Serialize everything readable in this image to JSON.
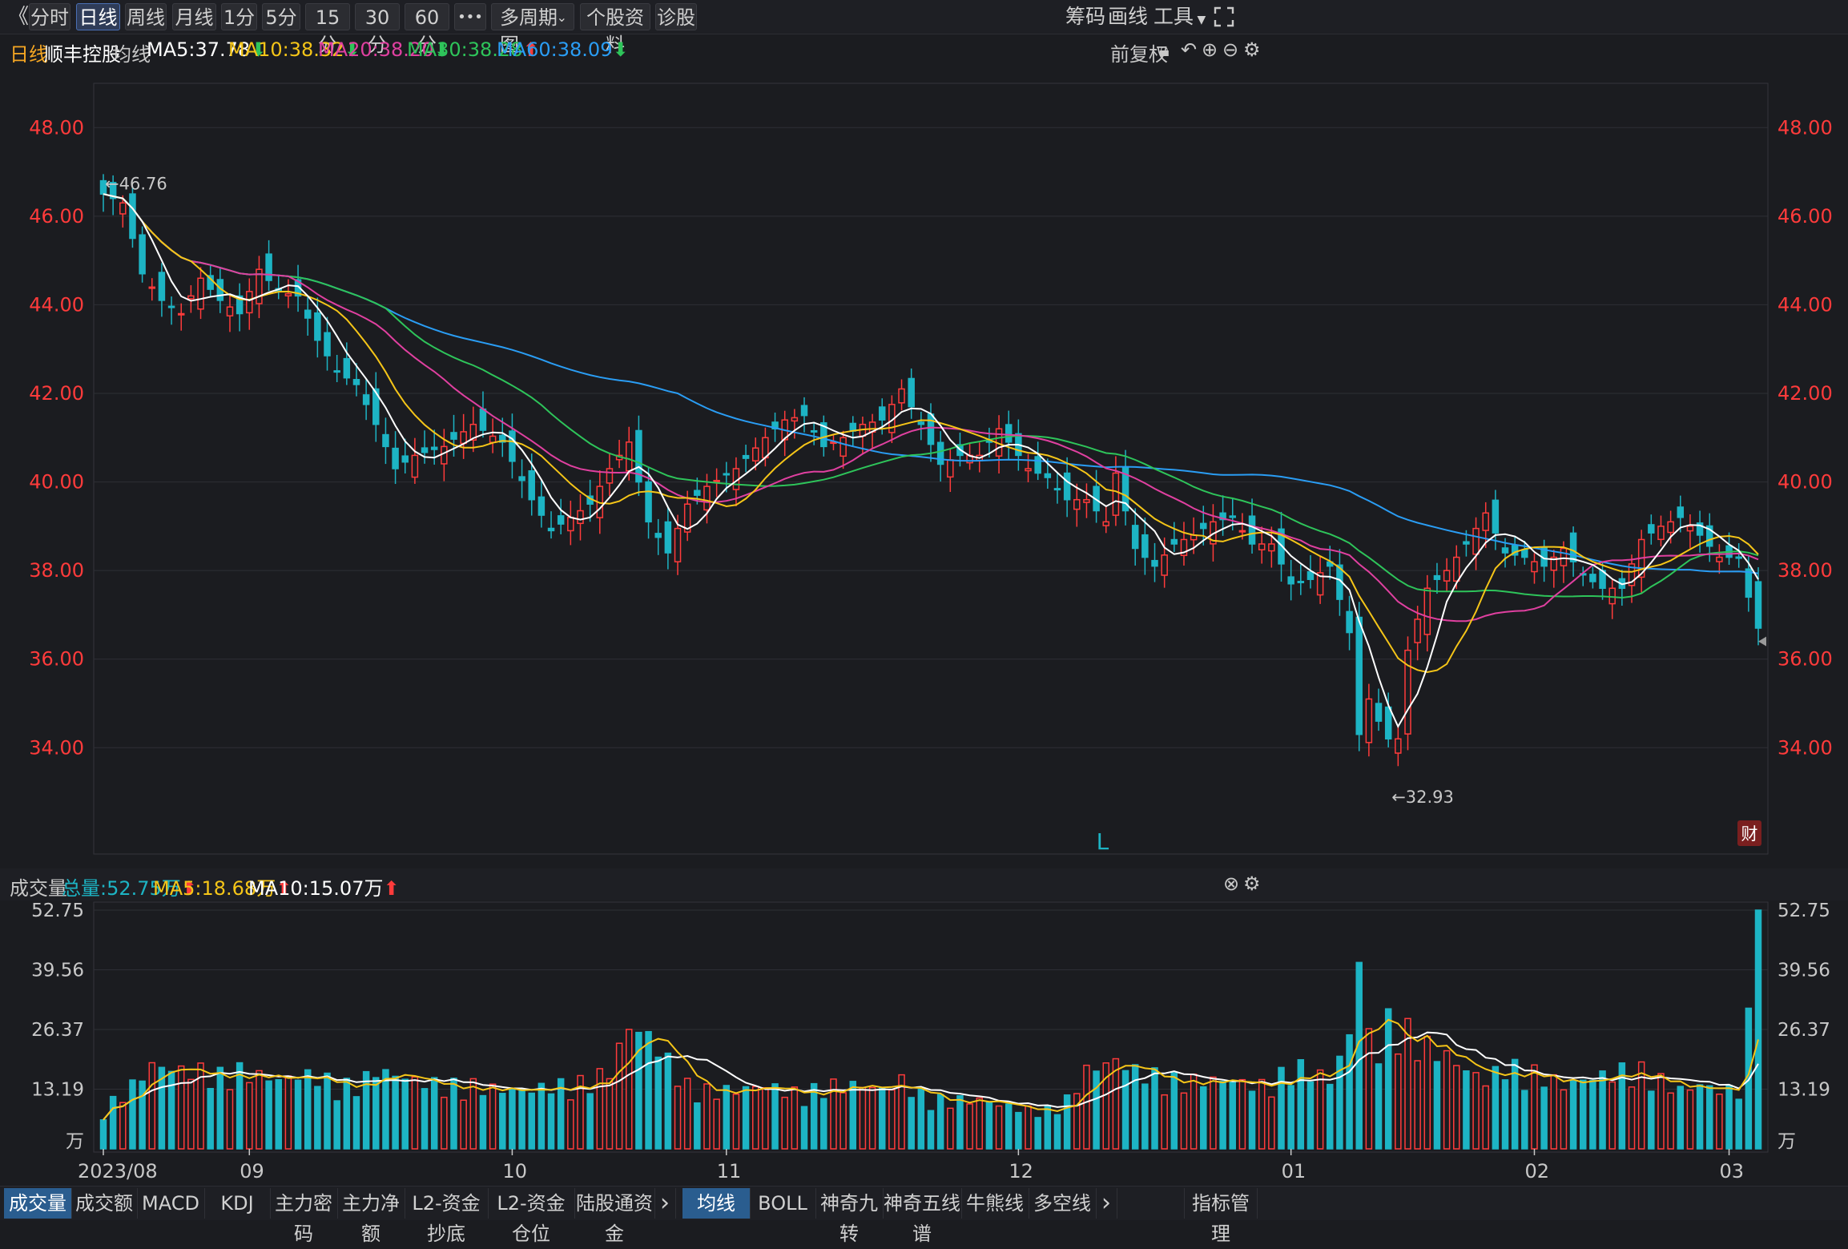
{
  "toolbar": {
    "back_glyph": "《",
    "periods": [
      "分时",
      "日线",
      "周线",
      "月线",
      "1分",
      "5分",
      "15分",
      "30分",
      "60分"
    ],
    "active_period": "日线",
    "more": "•••",
    "multi_period": "多周期图",
    "profile": "个股资料",
    "diagnose": "诊股",
    "right": [
      "筹码",
      "画线",
      "工具"
    ]
  },
  "ma_bar": {
    "period": "日线",
    "stock_name": "顺丰控股",
    "label": "均线",
    "ma5": "MA5:37.78",
    "ma10": "MA10:38.32",
    "ma20": "MA20:38.20",
    "ma30": "MA30:38.28",
    "ma60": "MA60:38.09",
    "adjust": "前复权"
  },
  "volume_bar": {
    "label": "成交量",
    "total": "总量:52.75万",
    "ma5": "MA5:18.68万",
    "ma10": "MA10:15.07万"
  },
  "chart_data": {
    "type": "candlestick",
    "price_axis": {
      "min": 31.6,
      "max": 49.0,
      "ticks": [
        "48.00",
        "46.00",
        "44.00",
        "42.00",
        "40.00",
        "38.00",
        "36.00",
        "34.00"
      ]
    },
    "volume_axis": {
      "max": 52.75,
      "ticks": [
        "52.75",
        "39.56",
        "26.37",
        "13.19"
      ],
      "unit": "万"
    },
    "x_labels": [
      "2023/08",
      "09",
      "10",
      "11",
      "12",
      "01",
      "02",
      "03"
    ],
    "annotations": {
      "high": "←46.76",
      "low": "←32.93",
      "marker": "L",
      "badge": "财"
    },
    "colors": {
      "up": "#ff3b3b",
      "down": "#1db4c4",
      "ma5": "#ffffff",
      "ma10": "#f5c518",
      "ma20": "#e040a0",
      "ma30": "#2ec45a",
      "ma60": "#2a9df4",
      "vol_ma5": "#f5c518",
      "vol_ma10": "#ffffff"
    },
    "anchors": [
      [
        0,
        46.5
      ],
      [
        2,
        46.3
      ],
      [
        4,
        44.7
      ],
      [
        6,
        44.1
      ],
      [
        8,
        43.8
      ],
      [
        10,
        44.6
      ],
      [
        12,
        44.1
      ],
      [
        14,
        43.8
      ],
      [
        16,
        44.8
      ],
      [
        18,
        44.3
      ],
      [
        20,
        44.2
      ],
      [
        22,
        43.2
      ],
      [
        24,
        42.5
      ],
      [
        26,
        42.2
      ],
      [
        28,
        41.3
      ],
      [
        30,
        40.3
      ],
      [
        32,
        40.6
      ],
      [
        35,
        40.8
      ],
      [
        38,
        41.3
      ],
      [
        41,
        40.9
      ],
      [
        44,
        39.6
      ],
      [
        46,
        38.9
      ],
      [
        48,
        39.2
      ],
      [
        50,
        39.5
      ],
      [
        52,
        40.3
      ],
      [
        54,
        40.9
      ],
      [
        56,
        39.1
      ],
      [
        58,
        38.4
      ],
      [
        60,
        39.5
      ],
      [
        62,
        39.9
      ],
      [
        65,
        40.3
      ],
      [
        68,
        41.0
      ],
      [
        70,
        41.4
      ],
      [
        72,
        41.5
      ],
      [
        74,
        40.8
      ],
      [
        76,
        41.0
      ],
      [
        78,
        41.3
      ],
      [
        80,
        41.4
      ],
      [
        82,
        42.1
      ],
      [
        84,
        41.3
      ],
      [
        86,
        40.4
      ],
      [
        88,
        40.6
      ],
      [
        90,
        40.6
      ],
      [
        92,
        41.2
      ],
      [
        95,
        40.3
      ],
      [
        97,
        40.1
      ],
      [
        99,
        39.6
      ],
      [
        101,
        39.6
      ],
      [
        103,
        39.1
      ],
      [
        104,
        40.2
      ],
      [
        106,
        38.5
      ],
      [
        108,
        38.1
      ],
      [
        110,
        38.6
      ],
      [
        112,
        38.8
      ],
      [
        114,
        39.1
      ],
      [
        116,
        39.2
      ],
      [
        118,
        38.6
      ],
      [
        120,
        38.6
      ],
      [
        122,
        37.7
      ],
      [
        124,
        37.8
      ],
      [
        126,
        38.1
      ],
      [
        128,
        36.6
      ],
      [
        129,
        34.3
      ],
      [
        130,
        35.1
      ],
      [
        131,
        34.6
      ],
      [
        132,
        34.2
      ],
      [
        133,
        34.2
      ],
      [
        134,
        36.2
      ],
      [
        136,
        37.6
      ],
      [
        138,
        38.0
      ],
      [
        140,
        38.6
      ],
      [
        142,
        39.3
      ],
      [
        144,
        38.4
      ],
      [
        146,
        38.3
      ],
      [
        148,
        38.1
      ],
      [
        150,
        38.5
      ],
      [
        152,
        37.9
      ],
      [
        154,
        37.6
      ],
      [
        156,
        37.6
      ],
      [
        158,
        38.7
      ],
      [
        160,
        39.0
      ],
      [
        162,
        39.2
      ],
      [
        164,
        38.8
      ],
      [
        166,
        38.3
      ],
      [
        168,
        38.3
      ],
      [
        169,
        37.4
      ],
      [
        170,
        36.7
      ]
    ],
    "vol_anchors": [
      [
        0,
        8
      ],
      [
        3,
        13
      ],
      [
        5,
        17
      ],
      [
        8,
        16
      ],
      [
        10,
        16
      ],
      [
        12,
        15
      ],
      [
        14,
        16
      ],
      [
        16,
        15
      ],
      [
        18,
        14
      ],
      [
        20,
        15
      ],
      [
        22,
        15
      ],
      [
        24,
        13
      ],
      [
        26,
        13
      ],
      [
        28,
        16
      ],
      [
        30,
        15
      ],
      [
        32,
        14
      ],
      [
        35,
        13
      ],
      [
        38,
        13
      ],
      [
        41,
        12
      ],
      [
        44,
        12
      ],
      [
        46,
        13
      ],
      [
        48,
        13
      ],
      [
        50,
        14
      ],
      [
        52,
        16
      ],
      [
        54,
        25
      ],
      [
        56,
        23
      ],
      [
        58,
        18
      ],
      [
        60,
        13
      ],
      [
        62,
        12
      ],
      [
        65,
        12
      ],
      [
        68,
        13
      ],
      [
        70,
        12
      ],
      [
        72,
        11
      ],
      [
        74,
        13
      ],
      [
        76,
        13
      ],
      [
        78,
        13
      ],
      [
        80,
        12
      ],
      [
        82,
        14
      ],
      [
        84,
        11
      ],
      [
        86,
        10
      ],
      [
        88,
        10
      ],
      [
        90,
        10
      ],
      [
        92,
        9
      ],
      [
        95,
        8
      ],
      [
        97,
        8
      ],
      [
        99,
        10
      ],
      [
        101,
        16
      ],
      [
        104,
        18
      ],
      [
        106,
        16
      ],
      [
        108,
        15
      ],
      [
        110,
        14
      ],
      [
        112,
        14
      ],
      [
        114,
        14
      ],
      [
        116,
        14
      ],
      [
        118,
        13
      ],
      [
        120,
        13
      ],
      [
        122,
        17
      ],
      [
        124,
        16
      ],
      [
        126,
        14
      ],
      [
        128,
        23
      ],
      [
        129,
        40
      ],
      [
        130,
        23
      ],
      [
        131,
        20
      ],
      [
        132,
        26
      ],
      [
        133,
        25
      ],
      [
        134,
        24
      ],
      [
        136,
        21
      ],
      [
        138,
        19
      ],
      [
        140,
        16
      ],
      [
        142,
        14
      ],
      [
        144,
        17
      ],
      [
        146,
        16
      ],
      [
        148,
        15
      ],
      [
        150,
        13
      ],
      [
        152,
        14
      ],
      [
        154,
        15
      ],
      [
        156,
        16
      ],
      [
        158,
        16
      ],
      [
        160,
        14
      ],
      [
        162,
        12
      ],
      [
        164,
        13
      ],
      [
        166,
        12
      ],
      [
        168,
        12
      ],
      [
        169,
        26
      ],
      [
        170,
        52.75
      ]
    ]
  },
  "bottom_tabs": [
    "成交量",
    "成交额",
    "MACD",
    "KDJ",
    "主力密码",
    "主力净额",
    "L2-资金抄底",
    "L2-资金仓位",
    "陆股通资金"
  ],
  "bottom_tabs2": [
    "均线",
    "BOLL",
    "神奇九转",
    "神奇五线谱",
    "牛熊线",
    "多空线"
  ],
  "bottom_more": "›",
  "indicator_manage": "指标管理"
}
